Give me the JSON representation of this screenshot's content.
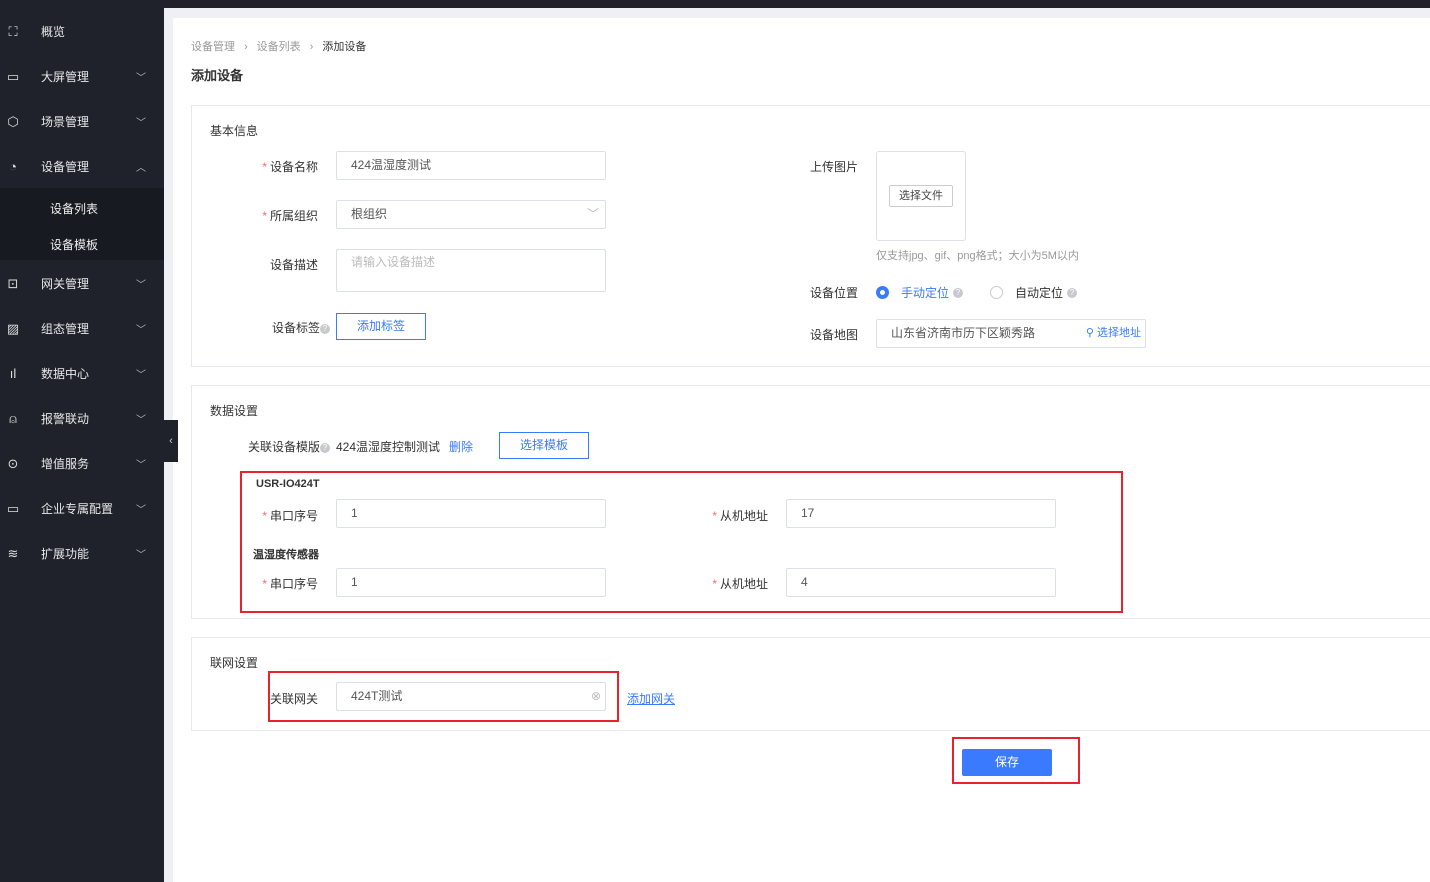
{
  "sidebar": {
    "items": [
      {
        "label": "概览",
        "icon": "scan-icon"
      },
      {
        "label": "大屏管理",
        "icon": "monitor-icon"
      },
      {
        "label": "场景管理",
        "icon": "cube-icon"
      },
      {
        "label": "设备管理",
        "icon": "pie-chart-icon"
      },
      {
        "label": "网关管理",
        "icon": "gateway-icon"
      },
      {
        "label": "组态管理",
        "icon": "image-icon"
      },
      {
        "label": "数据中心",
        "icon": "bar-chart-icon"
      },
      {
        "label": "报警联动",
        "icon": "alarm-icon"
      },
      {
        "label": "增值服务",
        "icon": "yen-icon"
      },
      {
        "label": "企业专属配置",
        "icon": "code-monitor-icon"
      },
      {
        "label": "扩展功能",
        "icon": "layers-icon"
      }
    ],
    "sub": [
      "设备列表",
      "设备模板"
    ]
  },
  "breadcrumb": [
    "设备管理",
    "设备列表",
    "添加设备"
  ],
  "page_title": "添加设备",
  "basic": {
    "title": "基本信息",
    "name_label": "设备名称",
    "name_value": "424温湿度测试",
    "org_label": "所属组织",
    "org_value": "根组织",
    "desc_label": "设备描述",
    "desc_placeholder": "请输入设备描述",
    "tag_label": "设备标签",
    "tag_button": "添加标签",
    "upload_label": "上传图片",
    "upload_button": "选择文件",
    "upload_hint": "仅支持jpg、gif、png格式；大小为5M以内",
    "location_label": "设备位置",
    "loc_manual": "手动定位",
    "loc_auto": "自动定位",
    "map_label": "设备地图",
    "map_value": "山东省济南市历下区颖秀路",
    "map_button": "选择地址"
  },
  "data": {
    "title": "数据设置",
    "template_label": "关联设备模版",
    "template_value": "424温湿度控制测试",
    "delete": "删除",
    "choose_template": "选择模板",
    "groups": [
      {
        "name": "USR-IO424T",
        "port_label": "串口序号",
        "port": "1",
        "addr_label": "从机地址",
        "addr": "17"
      },
      {
        "name": "温湿度传感器",
        "port_label": "串口序号",
        "port": "1",
        "addr_label": "从机地址",
        "addr": "4"
      }
    ]
  },
  "network": {
    "title": "联网设置",
    "gateway_label": "关联网关",
    "gateway_value": "424T测试",
    "add_gateway": "添加网关"
  },
  "save": "保存",
  "colors": {
    "primary": "#3a7afe",
    "sidebar": "#1f222b",
    "highlight": "#e8232d"
  }
}
